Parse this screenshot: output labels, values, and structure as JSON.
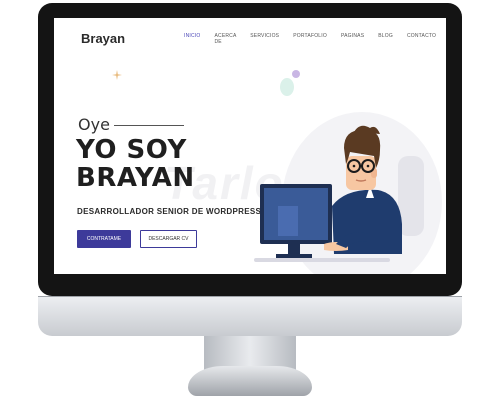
{
  "site": {
    "brand": "Brayan",
    "nav": [
      "INICIO",
      "ACERCA DE",
      "SERVICIOS",
      "PORTAFOLIO",
      "PAGINAS",
      "BLOG",
      "CONTACTO"
    ],
    "active_nav": "INICIO"
  },
  "hero": {
    "greeting": "Oye",
    "title_line1": "YO SOY",
    "title_line2": "BRAYAN",
    "background_word": "Tarlon",
    "subtitle": "DESARROLLADOR SENIOR DE WORDPRESS",
    "primary_button": "CONTRATAME",
    "secondary_button": "DESCARGAR CV"
  },
  "colors": {
    "accent": "#3d3a9a",
    "monitor_bezel": "#141414",
    "hair": "#5a3a22",
    "shirt": "#1f3c6e"
  },
  "icons": {
    "sparkle": "sparkle-icon",
    "illustration": "developer-at-computer-illustration"
  }
}
